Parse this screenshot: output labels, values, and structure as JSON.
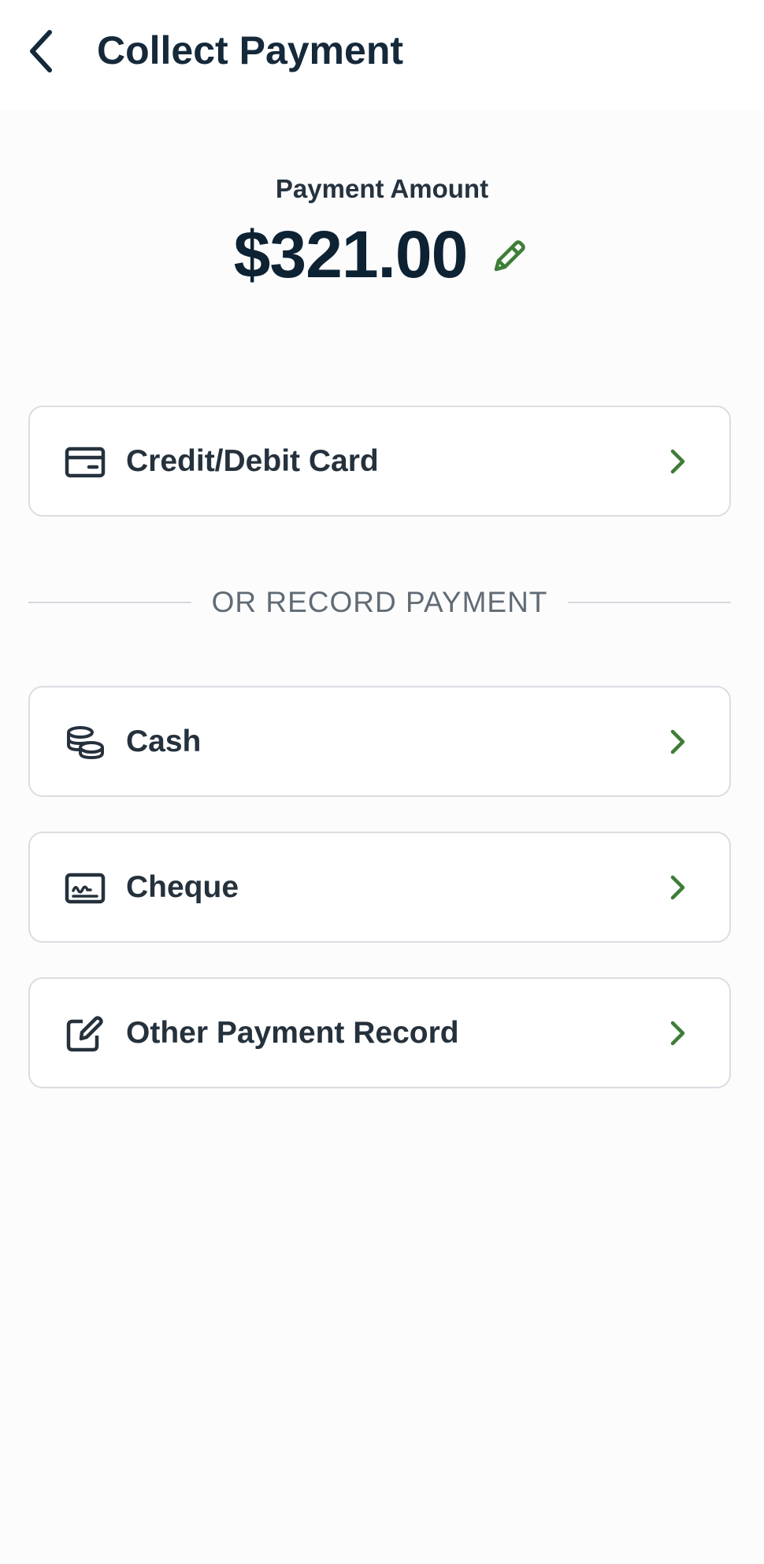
{
  "header": {
    "title": "Collect Payment",
    "back_icon": "chevron-left-icon"
  },
  "payment": {
    "label": "Payment Amount",
    "amount": "$321.00",
    "edit_icon": "pencil-icon"
  },
  "primary_option": {
    "label": "Credit/Debit Card",
    "icon": "credit-card-icon"
  },
  "divider": {
    "text": "OR RECORD PAYMENT"
  },
  "record_options": [
    {
      "label": "Cash",
      "icon": "coins-icon"
    },
    {
      "label": "Cheque",
      "icon": "cheque-icon"
    },
    {
      "label": "Other Payment Record",
      "icon": "edit-square-icon"
    }
  ],
  "colors": {
    "text_dark": "#15293a",
    "accent_green": "#3e7d36",
    "border": "#dadde1",
    "muted": "#606b75"
  }
}
